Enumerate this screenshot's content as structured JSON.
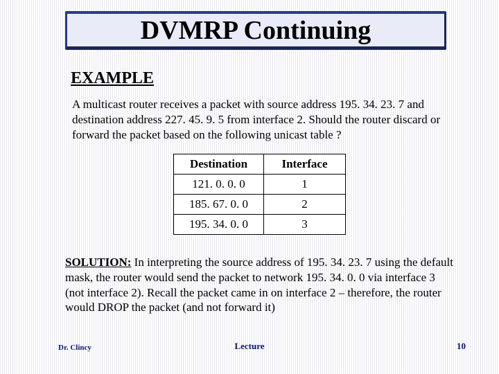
{
  "title": "DVMRP Continuing",
  "example_label": "EXAMPLE",
  "intro": "A multicast router receives a packet with source address 195. 34. 23. 7 and destination address 227. 45. 9. 5 from interface 2.  Should the router discard or forward the packet based on the following unicast table ?",
  "table": {
    "headers": [
      "Destination",
      "Interface"
    ],
    "rows": [
      [
        "121. 0. 0. 0",
        "1"
      ],
      [
        "185. 67. 0. 0",
        "2"
      ],
      [
        "195. 34. 0. 0",
        "3"
      ]
    ]
  },
  "solution_label": "SOLUTION:",
  "solution_body": " In interpreting the source address of 195. 34. 23. 7 using the default mask, the router would send the packet to network 195. 34. 0. 0 via interface 3 (not interface 2).  Recall the packet came in on interface 2 – therefore, the router would DROP the packet (and not forward it)",
  "footer": {
    "author": "Dr. Clincy",
    "center": "Lecture",
    "page": "10"
  }
}
